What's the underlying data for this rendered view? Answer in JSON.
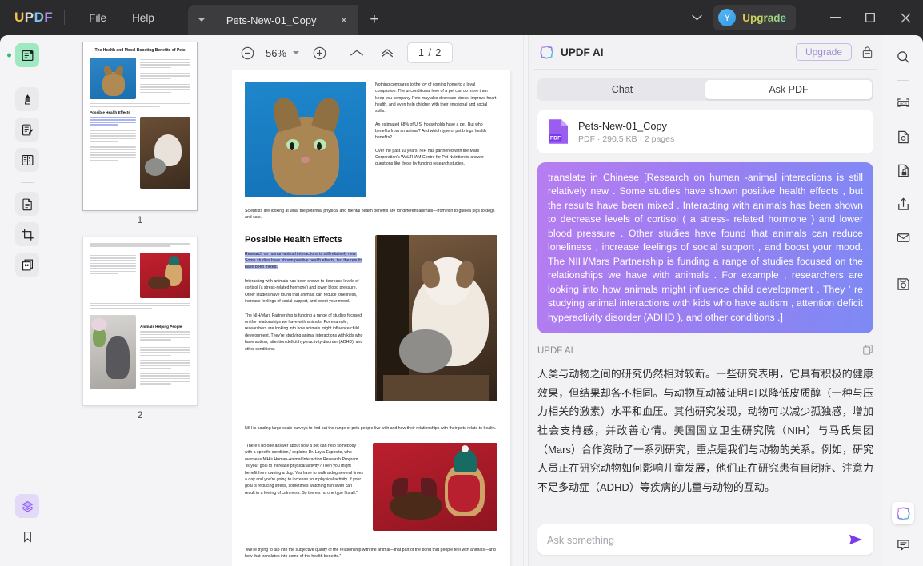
{
  "app": {
    "logo": "UPDF",
    "menus": [
      "File",
      "Help"
    ]
  },
  "tabs": {
    "active_title": "Pets-New-01_Copy",
    "close_glyph": "×",
    "add_glyph": "+"
  },
  "titlebar": {
    "upgrade_label": "Upgrade",
    "avatar_initial": "Y",
    "minimize": "—",
    "maximize": "□",
    "close": "✕"
  },
  "left_rail": {
    "items": [
      {
        "name": "reader-view",
        "state": "active"
      },
      {
        "name": "comment-markup",
        "state": "normal"
      },
      {
        "name": "edit-pdf",
        "state": "normal"
      },
      {
        "name": "page-organize",
        "state": "normal"
      },
      {
        "name": "convert-pdf",
        "state": "normal"
      },
      {
        "name": "crop-page",
        "state": "normal"
      },
      {
        "name": "ocr-pages",
        "state": "normal"
      }
    ],
    "bottom": [
      {
        "name": "layers-panel",
        "state": "active"
      },
      {
        "name": "bookmark-panel",
        "state": "normal"
      }
    ]
  },
  "right_rail": {
    "items": [
      "search-icon",
      "ocr-icon",
      "convert-icon",
      "protect-icon",
      "share-icon",
      "email-icon",
      "save-icon"
    ],
    "bottom": [
      "updf-ai-icon",
      "comment-icon"
    ]
  },
  "thumbnails": {
    "pages": [
      {
        "label": "1",
        "selected": true
      },
      {
        "label": "2",
        "selected": false
      }
    ],
    "page1_title": "The Health and Mood-Boosting Benefits of Pets",
    "page1_heading": "Possible Health Effects",
    "page2_heading": "Animals Helping People"
  },
  "doc_toolbar": {
    "zoom_out": "⊖",
    "zoom_value": "56%",
    "zoom_in": "⊕",
    "fit_page": "fit-page-icon",
    "fit_width": "fit-width-icon",
    "page_indicator": "1 / 2"
  },
  "document": {
    "intro_p1": "Nothing compares to the joy of coming home to a loyal companion. The unconditional love of a pet can do more than keep you company. Pets may also decrease stress, improve heart health, and even help children with their emotional and social skills.",
    "intro_p2": "An estimated 68% of U.S. households have a pet. But who benefits from an animal? And which type of pet brings health benefits?",
    "intro_p3": "Over the past 10 years, NIH has partnered with the Mars Corporation's WALTHAM Centre for Pet Nutrition to answer questions like these by funding research studies.",
    "caption": "Scientists are looking at what the potential physical and mental health benefits are for different animals—from fish to guinea pigs to dogs and cats.",
    "section_heading": "Possible Health Effects",
    "highlighted": "Research on human-animal interactions is still relatively new. Some studies have shown positive health effects, but the results have been mixed.",
    "para2": "Interacting with animals has been shown to decrease levels of cortisol (a stress-related hormone) and lower blood pressure. Other studies have found that animals can reduce loneliness, increase feelings of social support, and boost your mood.",
    "para3": "The NIH/Mars Partnership is funding a range of studies focused on the relationships we have with animals. For example, researchers are looking into how animals might influence child development. They're studying animal interactions with kids who have autism, attention deficit hyperactivity disorder (ADHD), and other conditions.",
    "para4": "NIH is funding large-scale surveys to find out the range of pets people live with and how their relationships with their pets relate to health.",
    "quote1": "“There's no one answer about how a pet can help somebody with a specific condition,” explains Dr. Layla Esposito, who oversees NIH's Human-Animal Interaction Research Program. “Is your goal to increase physical activity? Then you might benefit from owning a dog. You have to walk a dog several times a day and you're going to increase your physical activity. If your goal is reducing stress, sometimes watching fish swim can result in a feeling of calmness. So there's no one type fits all.”",
    "quote2": "“We're trying to tap into the subjective quality of the relationship with the animal—that part of the bond that people feel with animals—and how that translates into some of the health benefits.”"
  },
  "ai_panel": {
    "title": "UPDF AI",
    "upgrade_label": "Upgrade",
    "tabs": [
      {
        "label": "Chat",
        "active": false
      },
      {
        "label": "Ask PDF",
        "active": true
      }
    ],
    "file": {
      "name": "Pets-New-01_Copy",
      "meta": "PDF · 290.5 KB · 2 pages",
      "badge": "PDF"
    },
    "prompt": "translate in Chinese [Research on human -animal interactions is still relatively new . Some studies have shown positive health effects , but the results have been mixed . Interacting with animals has been shown to decrease levels of cortisol ( a stress- related hormone ) and lower blood pressure . Other studies have found that animals can reduce loneliness , increase feelings of social support , and boost your mood. The NIH/Mars Partnership is funding a range of studies focused on the relationships we have with animals . For example , researchers are looking into how animals might influence child development . They ' re studying animal interactions with kids who have autism , attention deficit hyperactivity disorder (ADHD ), and other conditions .]",
    "reply_label": "UPDF AI",
    "reply": "人类与动物之间的研究仍然相对较新。一些研究表明，它具有积极的健康效果，但结果却各不相同。与动物互动被证明可以降低皮质醇（一种与压力相关的激素）水平和血压。其他研究发现，动物可以减少孤独感，增加社会支持感，并改善心情。美国国立卫生研究院（NIH）与马氏集团（Mars）合作资助了一系列研究，重点是我们与动物的关系。例如，研究人员正在研究动物如何影响儿童发展，他们正在研究患有自闭症、注意力不足多动症（ADHD）等疾病的儿童与动物的互动。",
    "input_placeholder": "Ask something",
    "input_value": ""
  },
  "colors": {
    "titlebar_bg": "#2b2b2d",
    "panel_bg": "#f4f4f6",
    "accent_purple": "#7c3aed",
    "bubble_from": "#b77df0",
    "bubble_to": "#7d8af4",
    "highlight_blue": "#aab4ee",
    "active_green": "#9fe8c0"
  }
}
